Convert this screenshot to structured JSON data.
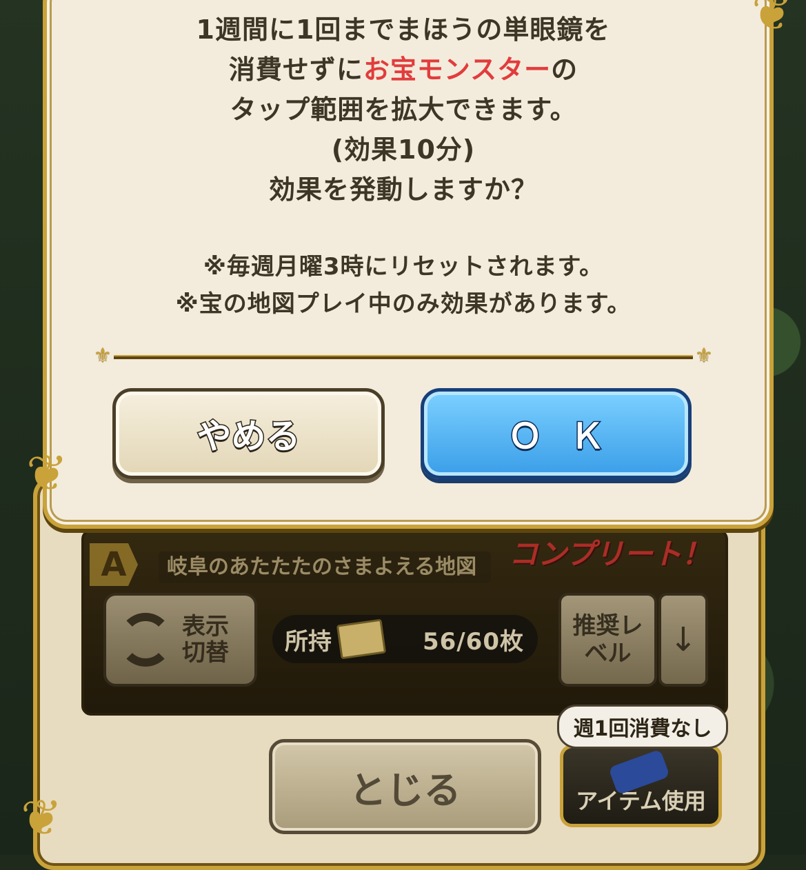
{
  "dialog": {
    "message_lines": [
      "1週間に1回までまほうの単眼鏡を",
      "消費せずに",
      "お宝モンスター",
      "の",
      "タップ範囲を拡大できます。",
      "(効果10分)",
      "効果を発動しますか？"
    ],
    "notes": [
      "※毎週月曜3時にリセットされます。",
      "※宝の地図プレイ中のみ効果があります。"
    ],
    "cancel_label": "やめる",
    "ok_label": "ＯＫ"
  },
  "map_panel": {
    "rank": "A",
    "map_name": "岐阜のあたたたのさまよえる地図",
    "complete_badge": "コンプリート！",
    "toggle_label": "表示切替",
    "owned_label": "所持",
    "owned_count": "56/60枚",
    "recommended_level_label": "推奨レベル",
    "sort_arrow": "↓",
    "close_label": "とじる",
    "item_use_label": "アイテム使用",
    "item_bubble": "週1回消費なし"
  },
  "colors": {
    "highlight": "#e23c3c",
    "ok_button": "#3a9ee8",
    "frame_gold": "#c9a23a"
  }
}
